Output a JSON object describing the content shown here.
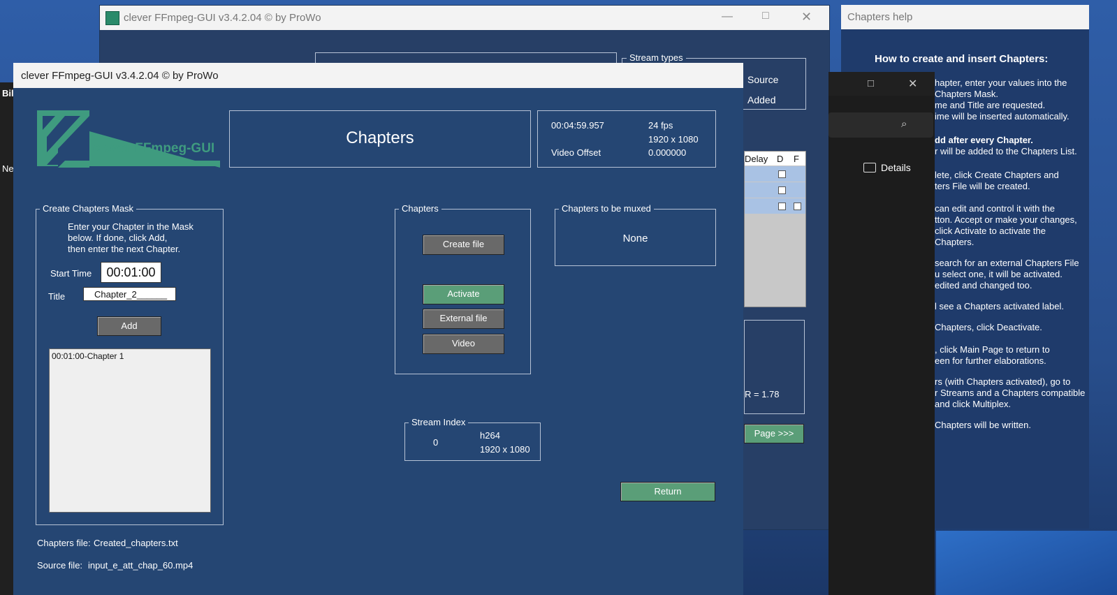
{
  "back_window": {
    "title": "clever FFmpeg-GUI v3.4.2.04   © by ProWo",
    "stream_types_title": "Stream types",
    "stream_source": "Source",
    "stream_added": "Added",
    "table_headers": [
      "Delay",
      "D",
      "F"
    ],
    "aspect": "R = 1.78",
    "main_page_button": "Page >>>"
  },
  "explorer": {
    "details_label": "Details"
  },
  "help_window": {
    "title": "Chapters help",
    "heading": "How to create and insert Chapters:",
    "lines": [
      "hapter, enter your values into the",
      "Chapters Mask.",
      "me and Title are requested.",
      "ime will be inserted automatically.",
      "dd after every Chapter.",
      "r will be added to the Chapters List.",
      "lete, click Create Chapters and",
      "ters File will be created.",
      "can edit and control it with the",
      "tton. Accept or make your changes,",
      "click Activate to activate the",
      "Chapters.",
      "search for an external Chapters File",
      "u select one, it will be activated.",
      "edited and changed too.",
      "l see a Chapters activated label.",
      "Chapters, click Deactivate.",
      ", click Main Page to return to",
      "een for further elaborations.",
      "rs (with Chapters activated), go to",
      "r Streams and a Chapters compatible",
      "and click Multiplex.",
      "Chapters will be written."
    ]
  },
  "left_strip": {
    "label_top": "Bil",
    "label_ne": "Ne"
  },
  "front_window": {
    "title": "clever FFmpeg-GUI v3.4.2.04   © by ProWo",
    "logo_text": "clever FFmpeg-GUI",
    "page_title": "Chapters",
    "info": {
      "duration": "00:04:59.957",
      "fps": "24 fps",
      "resolution": "1920 x 1080",
      "offset_label": "Video Offset",
      "offset_value": "0.000000"
    },
    "mask": {
      "title": "Create Chapters Mask",
      "instructions": [
        "Enter your Chapter in the Mask",
        "below. If done, click Add,",
        "then enter the next Chapter."
      ],
      "start_time_label": "Start Time",
      "start_time_value": "00:01:00",
      "title_label": "Title",
      "title_value": "Chapter_2______",
      "add_button": "Add",
      "list_items": [
        "00:01:00-Chapter 1"
      ]
    },
    "chapters_box": {
      "title": "Chapters",
      "create_file": "Create file",
      "activate": "Activate",
      "external_file": "External file",
      "video": "Video"
    },
    "muxed_box": {
      "title": "Chapters to be muxed",
      "value": "None"
    },
    "stream_index": {
      "title": "Stream Index",
      "index": "0",
      "codec": "h264",
      "resolution": "1920 x 1080"
    },
    "return_button": "Return",
    "chapters_file_label": "Chapters file:",
    "chapters_file_value": "Created_chapters.txt",
    "source_file_label": "Source file:",
    "source_file_value": "input_e_att_chap_60.mp4"
  }
}
